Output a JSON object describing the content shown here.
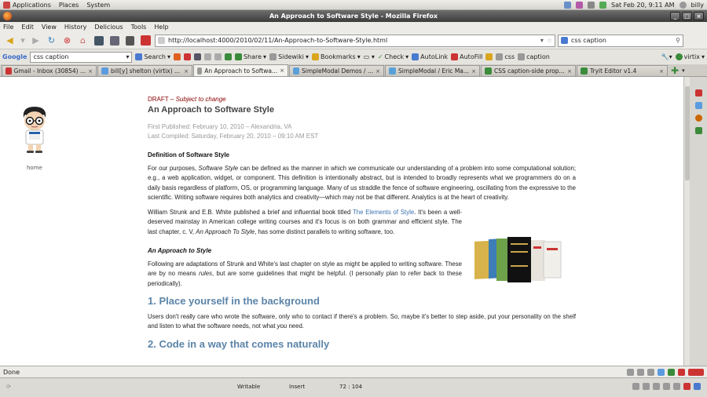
{
  "gnome": {
    "applications": "Applications",
    "places": "Places",
    "system": "System",
    "datetime": "Sat Feb 20,  9:11 AM",
    "user": "billy"
  },
  "window": {
    "title": "An Approach to Software Style - Mozilla Firefox"
  },
  "menu": [
    "File",
    "Edit",
    "View",
    "History",
    "Delicious",
    "Tools",
    "Help"
  ],
  "nav": {
    "url": "http://localhost:4000/2010/02/11/An-Approach-to-Software-Style.html",
    "search": "css caption"
  },
  "toolbar": {
    "google_logo": "Google",
    "google_query": "css caption",
    "search": "Search",
    "share": "Share",
    "sidewiki": "Sidewiki",
    "bookmarks": "Bookmarks",
    "check": "Check",
    "autolink": "AutoLink",
    "autofill": "AutoFill",
    "css": "css",
    "caption": "caption",
    "virtix": "virtix"
  },
  "tabs": [
    {
      "label": "Gmail - Inbox (30854) ...",
      "color": "#c33"
    },
    {
      "label": "bill[y] shelton (virtix) ...",
      "color": "#5a9be0"
    },
    {
      "label": "An Approach to Softwa...",
      "color": "#999"
    },
    {
      "label": "SimpleModal Demos / ...",
      "color": "#5aa0d8"
    },
    {
      "label": "SimpleModal / Eric Ma...",
      "color": "#5aa0d8"
    },
    {
      "label": "CSS caption-side prop...",
      "color": "#3b8c3b"
    },
    {
      "label": "Tryit Editor v1.4",
      "color": "#3b8c3b"
    }
  ],
  "page": {
    "home": "home",
    "draft": "DRAFT",
    "draft_dash": " – ",
    "draft_note": "Subject to change",
    "title": "An Approach to Software Style",
    "published": "First Published: February 10, 2010 – Alexandria, VA",
    "compiled": "Last Compiled: Saturday, February 20, 2010 – 09:10 AM EST",
    "h_def": "Definition of Software Style",
    "p1_a": "For our purposes, ",
    "p1_em": "Software Style",
    "p1_b": " can be defined as the manner in which we communicate our understanding of a problem into some computational solution; e.g., a web application, widget, or component. This definition is intentionally abstract, but is intended to broadly represents what we programmers do on a daily basis regardless of platform, OS, or programming language. Many of us straddle the fence of software engineering, oscillating from the expressive to the scientific. Writing software requires both analytics and creativity—which may not be that different. Analytics is at the heart of creativity.",
    "p2_a": "William Strunk and E.B. White published a brief and influential book titled ",
    "p2_link": "The Elements of Style",
    "p2_b": ". It's been a well-deserved mainstay in American college writing courses and it's focus is on both grammar and efficient style. The last chapter, c. V, ",
    "p2_em": "An Approach To Style",
    "p2_c": ", has some distinct parallels to writing software, too.",
    "h_approach": "An Approach to Style",
    "p3_a": "Following are adaptations of Strunk and White's last chapter on style as might be applied to writing software. These are by no means ",
    "p3_em": "rules",
    "p3_b": ", but are some guidelines that might be helpful. (I personally plan to refer back to these periodically).",
    "h1": "1. Place yourself in the background",
    "p4_a": "Users don't really care who wrote the software, only who to contact if there's a problem. So, maybe it's better to step aside, put your personality on the shelf and listen to what the software needs, not what ",
    "p4_em": "you",
    "p4_b": " need.",
    "h2": "2. Code in a way that comes naturally"
  },
  "status": {
    "text": "Done"
  },
  "editor": {
    "mode": "Writable",
    "insert": "Insert",
    "pos": "72 : 104"
  }
}
